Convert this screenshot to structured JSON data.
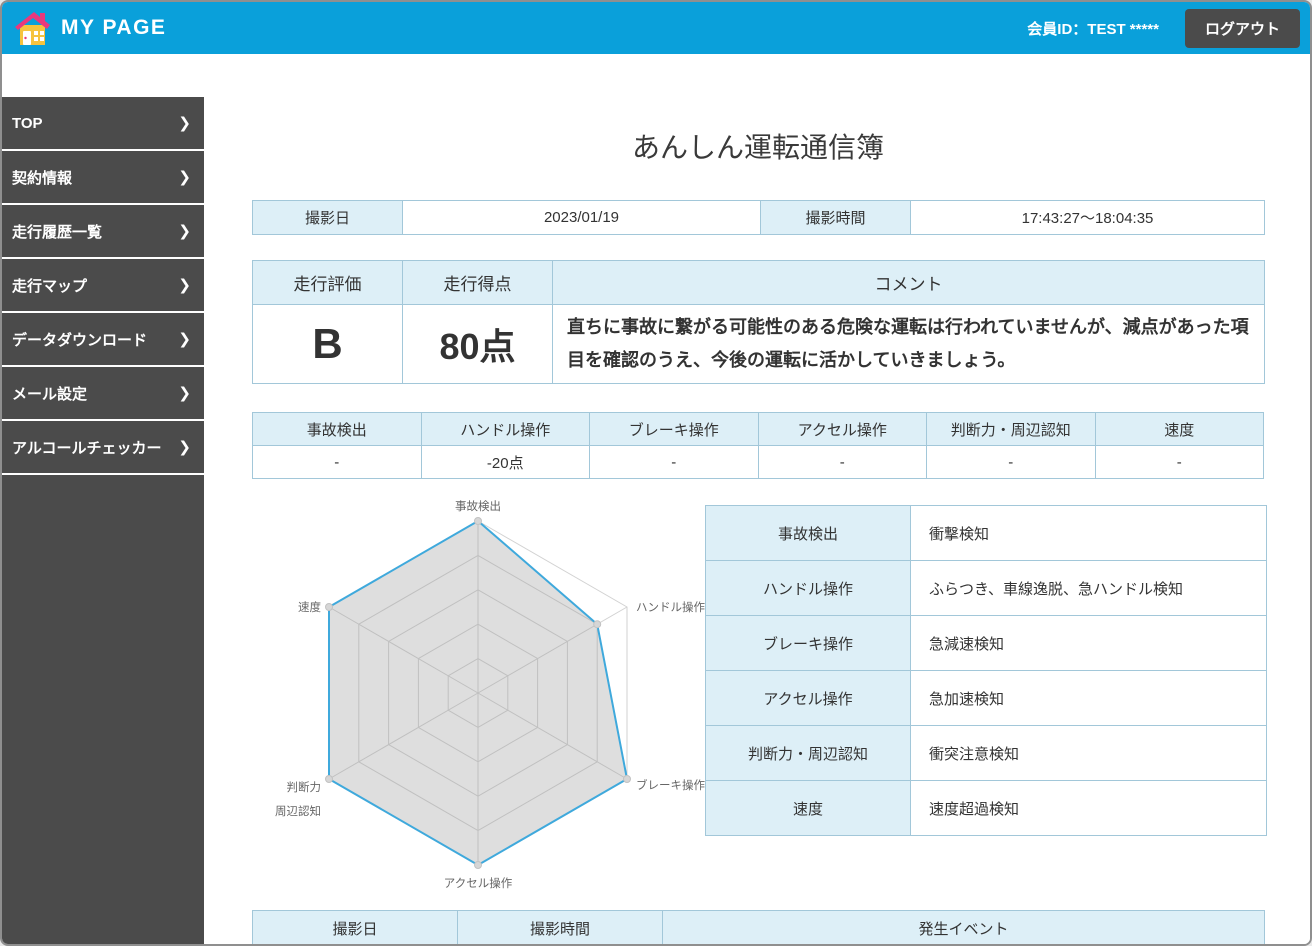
{
  "theme": {
    "header_bg": "#0aa0da",
    "sidebar_bg": "#4b4b4b",
    "cell_blue": "#ddeff7",
    "table_border": "#a2c7d9",
    "text": "#333333"
  },
  "header": {
    "brand": "MY PAGE",
    "member_id": "会員ID：TEST *****",
    "logout_label": "ログアウト"
  },
  "sidebar": {
    "items": [
      {
        "label": "TOP"
      },
      {
        "label": "契約情報"
      },
      {
        "label": "走行履歴一覧"
      },
      {
        "label": "走行マップ"
      },
      {
        "label": "データダウンロード"
      },
      {
        "label": "メール設定"
      },
      {
        "label": "アルコールチェッカー"
      }
    ]
  },
  "page": {
    "title": "あんしん運転通信簿"
  },
  "photo_info": {
    "date_label": "撮影日",
    "date": "2023/01/19",
    "time_label": "撮影時間",
    "time": "17:43:27〜18:04:35"
  },
  "rating": {
    "eval_label": "走行評価",
    "score_label": "走行得点",
    "comment_label": "コメント",
    "eval": "B",
    "score": "80点",
    "comment": "直ちに事故に繋がる可能性のある危険な運転は行われていませんが、減点があった項目を確認のうえ、今後の運転に活かしていきましょう。"
  },
  "breakdown": {
    "columns": [
      {
        "label": "事故検出",
        "value": "-"
      },
      {
        "label": "ハンドル操作",
        "value": "-20点"
      },
      {
        "label": "ブレーキ操作",
        "value": "-"
      },
      {
        "label": "アクセル操作",
        "value": "-"
      },
      {
        "label": "判断力・周辺認知",
        "value": "-"
      },
      {
        "label": "速度",
        "value": "-"
      }
    ]
  },
  "detect_table": {
    "rows": [
      {
        "label": "事故検出",
        "desc": "衝撃検知"
      },
      {
        "label": "ハンドル操作",
        "desc": "ふらつき、車線逸脱、急ハンドル検知"
      },
      {
        "label": "ブレーキ操作",
        "desc": "急減速検知"
      },
      {
        "label": "アクセル操作",
        "desc": "急加速検知"
      },
      {
        "label": "判断力・周辺認知",
        "desc": "衝突注意検知"
      },
      {
        "label": "速度",
        "desc": "速度超過検知"
      }
    ]
  },
  "event_table": {
    "headers": [
      "撮影日",
      "撮影時間",
      "発生イベント"
    ]
  },
  "chart_data": {
    "type": "radar",
    "title": "",
    "categories": [
      "事故検出",
      "ハンドル操作",
      "ブレーキ操作",
      "アクセル操作",
      "判断力・周辺認知",
      "速度"
    ],
    "series": [
      {
        "name": "走行得点",
        "values": [
          100,
          80,
          100,
          100,
          100,
          100
        ]
      }
    ],
    "max": 100,
    "rings": 5,
    "grid": true,
    "legend": false,
    "axis_label_lines": [
      [
        "事故検出"
      ],
      [
        "ハンドル操作"
      ],
      [
        "ブレーキ操作"
      ],
      [
        "アクセル操作"
      ],
      [
        "判断力",
        "周辺認知"
      ],
      [
        "速度"
      ]
    ],
    "stroke_color": "#3fa9dc",
    "fill_color": "rgba(160,160,160,0.35)",
    "grid_color": "#d2d2d2",
    "point_color": "#d6d6d6",
    "label_color": "#666666"
  }
}
